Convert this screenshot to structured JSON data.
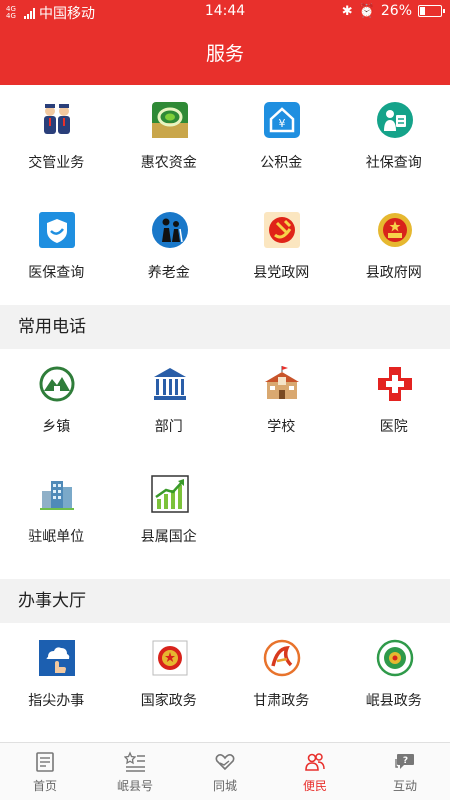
{
  "status_bar": {
    "network": "4G 4G",
    "carrier": "中国移动",
    "time": "14:44",
    "battery": "26%",
    "battery_level": 0.26
  },
  "header": {
    "title": "服务"
  },
  "services": [
    {
      "label": "交管业务",
      "icon": "traffic-police-icon"
    },
    {
      "label": "惠农资金",
      "icon": "farm-subsidy-icon"
    },
    {
      "label": "公积金",
      "icon": "housing-fund-icon"
    },
    {
      "label": "社保查询",
      "icon": "social-security-icon"
    },
    {
      "label": "医保查询",
      "icon": "medical-insurance-icon"
    },
    {
      "label": "养老金",
      "icon": "pension-icon"
    },
    {
      "label": "县党政网",
      "icon": "party-emblem-icon"
    },
    {
      "label": "县政府网",
      "icon": "national-emblem-icon"
    }
  ],
  "phones": {
    "title": "常用电话",
    "items": [
      {
        "label": "乡镇",
        "icon": "township-icon"
      },
      {
        "label": "部门",
        "icon": "department-building-icon"
      },
      {
        "label": "学校",
        "icon": "school-icon"
      },
      {
        "label": "医院",
        "icon": "hospital-cross-icon"
      },
      {
        "label": "驻岷单位",
        "icon": "office-building-icon"
      },
      {
        "label": "县属国企",
        "icon": "growth-chart-icon"
      }
    ]
  },
  "hall": {
    "title": "办事大厅",
    "items": [
      {
        "label": "指尖办事",
        "icon": "cloud-hand-icon"
      },
      {
        "label": "国家政务",
        "icon": "national-affairs-icon"
      },
      {
        "label": "甘肃政务",
        "icon": "gansu-affairs-icon"
      },
      {
        "label": "岷县政务",
        "icon": "minxian-affairs-icon"
      }
    ]
  },
  "tabs": [
    {
      "label": "首页",
      "icon": "home-news-icon",
      "active": false
    },
    {
      "label": "岷县号",
      "icon": "star-list-icon",
      "active": false
    },
    {
      "label": "同城",
      "icon": "heart-hand-icon",
      "active": false
    },
    {
      "label": "便民",
      "icon": "people-icon",
      "active": true
    },
    {
      "label": "互动",
      "icon": "chat-question-icon",
      "active": false
    }
  ],
  "colors": {
    "brand": "#e8302c",
    "section_bg": "#f2f2f2",
    "active_tab": "#e8302c"
  }
}
